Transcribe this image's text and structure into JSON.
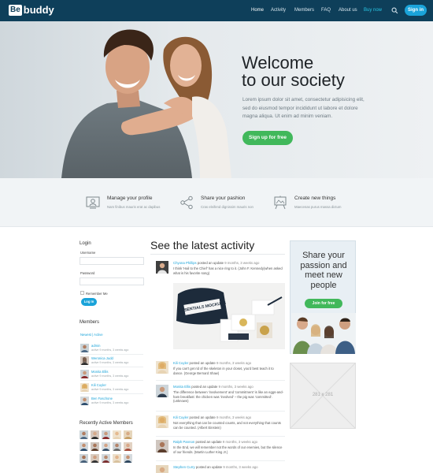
{
  "brand": {
    "box": "Be",
    "text": "buddy"
  },
  "nav": {
    "items": [
      "Home",
      "Activity",
      "Members",
      "FAQ",
      "About us",
      "Buy now"
    ],
    "signin": "Sign in"
  },
  "hero": {
    "title_line1": "Welcome",
    "title_line2": "to our society",
    "text": "Lorem ipsum dolor sit amet, consectetur adipisicing elit, sed do eiusmod tempor incididunt ut labore et dolore magna aliqua. Ut enim ad minim veniam.",
    "button": "Sign up for free"
  },
  "features": [
    {
      "icon": "profile-icon",
      "title": "Manage your profile",
      "subtitle": "Nam finibus mauris erat ac dapibus"
    },
    {
      "icon": "share-icon",
      "title": "Share your pashion",
      "subtitle": "Cras eleifend dignissim mauris non"
    },
    {
      "icon": "easel-icon",
      "title": "Create new things",
      "subtitle": "Maecenas purus massa dictum"
    }
  ],
  "login": {
    "heading": "Login",
    "username_label": "Username",
    "password_label": "Password",
    "remember": "Remember Me",
    "button": "Log In"
  },
  "members": {
    "heading": "Members",
    "tabs": "Newest | Active",
    "list": [
      {
        "name": "admin",
        "meta": "active 9 months, 3 weeks ago"
      },
      {
        "name": "Weronica Judd",
        "meta": "active 9 months, 3 weeks ago"
      },
      {
        "name": "Monita Ellis",
        "meta": "active 9 months, 3 weeks ago"
      },
      {
        "name": "Kili Cuyler",
        "meta": "active 9 months, 3 weeks ago"
      },
      {
        "name": "Ben Faschone",
        "meta": "active 9 months, 3 weeks ago"
      }
    ]
  },
  "recent": {
    "heading": "Recently Active Members"
  },
  "activity": {
    "heading": "See the latest activity",
    "posted": "posted an update",
    "items": [
      {
        "who": "Chyona Phillips",
        "time": "9 months, 3 weeks ago",
        "body": "I think 'Hail to the Chief' has a nice ring to it. (John F. Kennedy)when asked what is his favorite song)"
      },
      {
        "who": "Kili Cuyler",
        "time": "9 months, 3 weeks ago",
        "body": "If you can't get rid of the skeleton in your closet, you'd best teach it to dance. (George Bernard Shaw)"
      },
      {
        "who": "Monita Ellis",
        "time": "9 months, 3 weeks ago",
        "body": "The difference between 'involvement' and 'commitment' is like an eggs-and-ham breakfast: the chicken was 'involved' – the pig was 'committed'. (unknown)"
      },
      {
        "who": "Kili Cuyler",
        "time": "9 months, 3 weeks ago",
        "body": "Not everything that can be counted counts, and not everything that counts can be counted. (Albert Einstein)"
      },
      {
        "who": "Ralph Pannon",
        "time": "9 months, 3 weeks ago",
        "body": "In the End, we will remember not the words of our enemies, but the silence of our friends. (Martin Luther King Jr.)"
      },
      {
        "who": "Stephen Curry",
        "time": "9 months, 3 weeks ago",
        "body": ""
      }
    ]
  },
  "mockup": {
    "text": "ESSENTIALS MOCKUPS"
  },
  "promo": {
    "line1": "Share your",
    "line2": "passion and",
    "line3": "meet new",
    "line4": "people",
    "button": "Join for free"
  },
  "ad": {
    "label": "281 x 281"
  },
  "colors": {
    "nav_bg": "#0e3f5a",
    "accent": "#1aa3d9",
    "green": "#41b85b"
  }
}
